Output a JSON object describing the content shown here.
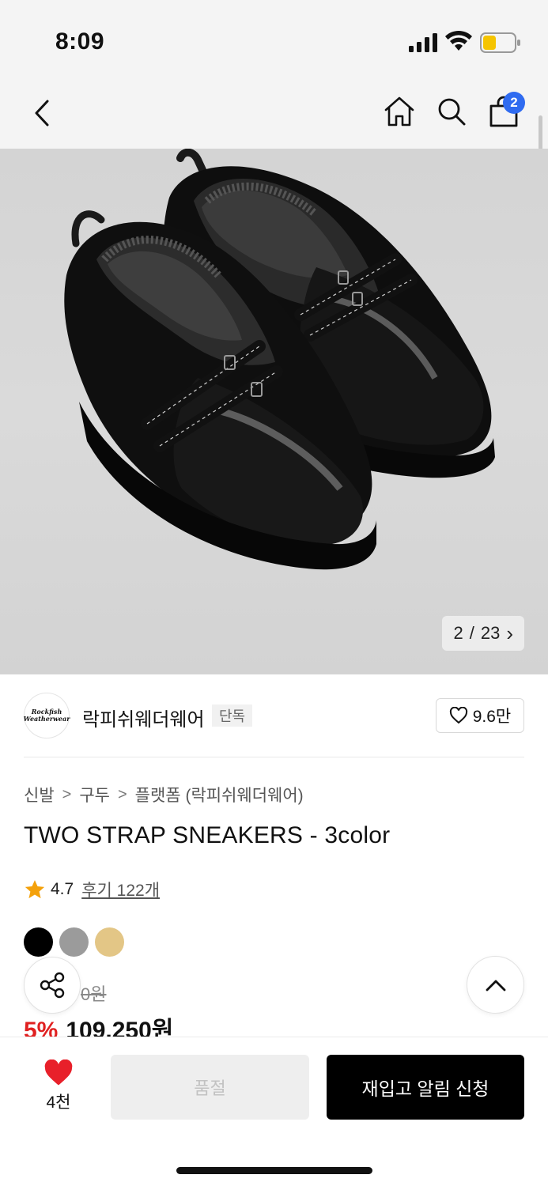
{
  "status": {
    "time": "8:09"
  },
  "nav": {
    "cart_count": "2"
  },
  "gallery": {
    "current": "2",
    "separator": "/",
    "total": "23",
    "next_glyph": "›"
  },
  "brand": {
    "name": "락피쉬웨더웨어",
    "tag": "단독",
    "logo_line1": "Rockfish",
    "logo_line2": "Weatherwear",
    "likes": "9.6만"
  },
  "breadcrumb": [
    "신발",
    "구두",
    "플랫폼 (락피쉬웨더웨어)"
  ],
  "product": {
    "title": "TWO STRAP SNEAKERS - 3color"
  },
  "rating": {
    "score": "4.7",
    "reviews_label": "후기 122개"
  },
  "colors": [
    "#000000",
    "#9b9b9b",
    "#e3c686"
  ],
  "price": {
    "original_fragment": "0원",
    "discount": "5%",
    "sale": "109,250원"
  },
  "bottom_bar": {
    "wish_count": "4천",
    "soldout_label": "품절",
    "restock_label": "재입고 알림 신청"
  },
  "accent": {
    "heart": "#e8202a",
    "badge": "#2f6bf0",
    "discount": "#e02020",
    "battery": "#f5c400"
  }
}
